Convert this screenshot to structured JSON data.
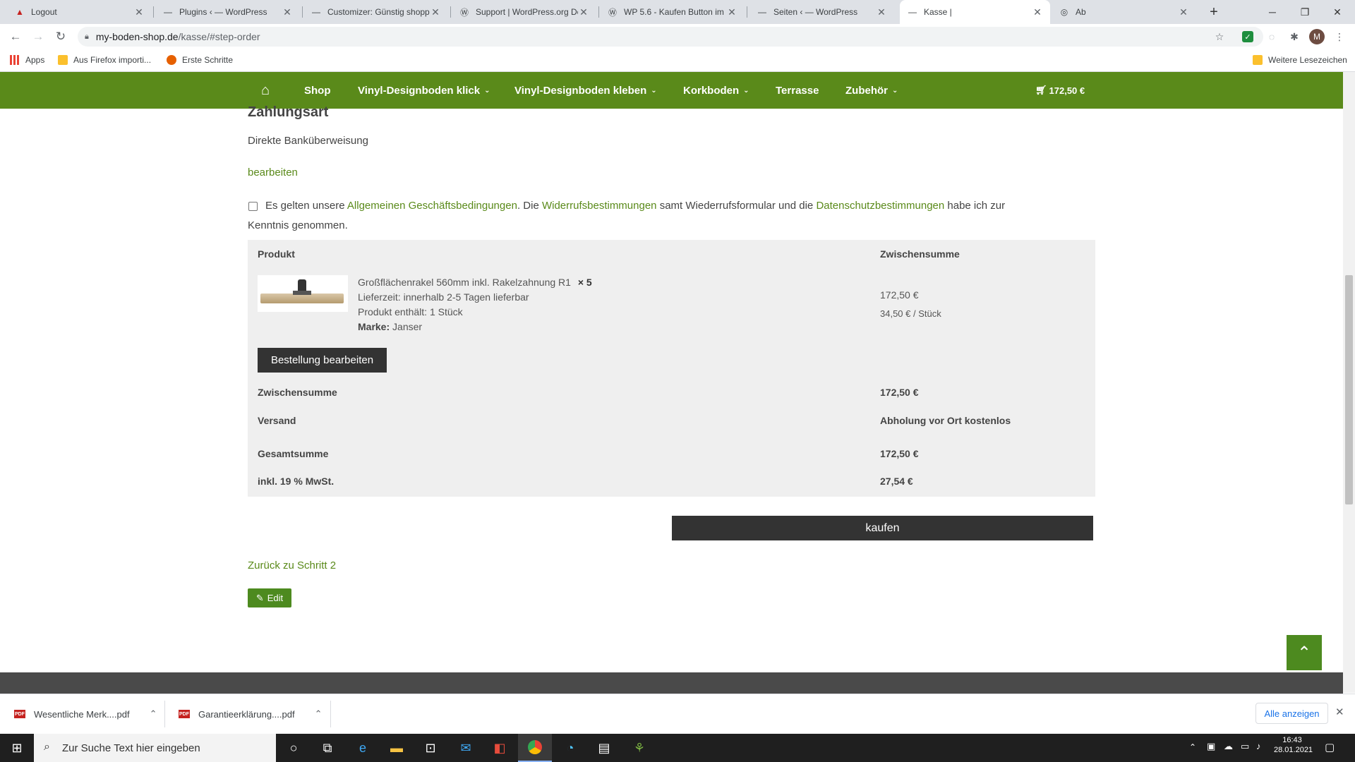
{
  "browser": {
    "tabs": [
      {
        "title": "Logout",
        "icon": "wp-icon",
        "active": false
      },
      {
        "title": "Plugins ‹ — WordPress",
        "icon": "dash-icon",
        "active": false
      },
      {
        "title": "Customizer: Günstig shoppe",
        "icon": "dash-icon",
        "active": false
      },
      {
        "title": "Support | WordPress.org De",
        "icon": "wordpress-icon",
        "active": false
      },
      {
        "title": "WP 5.6 - Kaufen Button im",
        "icon": "wordpress-icon",
        "active": false
      },
      {
        "title": "Seiten ‹ — WordPress",
        "icon": "dash-icon",
        "active": false
      },
      {
        "title": "Kasse |",
        "icon": "dash-icon",
        "active": true
      },
      {
        "title": "Ab",
        "icon": "globe-icon",
        "active": false
      }
    ],
    "url_host": "my-boden-shop.de",
    "url_path": "/kasse/#step-order",
    "profile_initial": "M",
    "bookmarks": {
      "apps": "Apps",
      "firefox": "Aus Firefox importi...",
      "first_steps": "Erste Schritte",
      "more": "Weitere Lesezeichen"
    }
  },
  "nav": {
    "items": [
      {
        "label": "Shop",
        "caret": false
      },
      {
        "label": "Vinyl-Designboden klick",
        "caret": true
      },
      {
        "label": "Vinyl-Designboden kleben",
        "caret": true
      },
      {
        "label": "Korkboden",
        "caret": true
      },
      {
        "label": "Terrasse",
        "caret": false
      },
      {
        "label": "Zubehör",
        "caret": true
      }
    ],
    "cart_total": "172,50 €"
  },
  "checkout": {
    "payment_heading": "Zahlungsart",
    "payment_method": "Direkte Banküberweisung",
    "edit_link": "bearbeiten",
    "terms": {
      "prefix": "Es gelten unsere",
      "agb": "Allgemeinen Geschäftsbedingungen",
      "mid1": ". Die",
      "widerruf": "Widerrufsbestimmungen",
      "mid2": "samt Wiederrufsformular und die",
      "datenschutz": "Datenschutzbestimmungen",
      "suffix": "habe ich zur",
      "line2": "Kenntnis genommen."
    },
    "table": {
      "col_product": "Produkt",
      "col_subtotal": "Zwischensumme",
      "product_name": "Großflächenrakel 560mm inkl. Rakelzahnung R1",
      "quantity": "× 5",
      "delivery": "Lieferzeit: innerhalb 2-5 Tagen lieferbar",
      "contains": "Produkt enthält: 1 Stück",
      "brand_label": "Marke:",
      "brand_value": "Janser",
      "line_price": "172,50 €",
      "unit_price": "34,50 € / Stück",
      "edit_order": "Bestellung bearbeiten",
      "subtotal_label": "Zwischensumme",
      "subtotal_value": "172,50 €",
      "shipping_label": "Versand",
      "shipping_value": "Abholung vor Ort kostenlos",
      "total_label": "Gesamtsumme",
      "total_value": "172,50 €",
      "tax_label": "inkl. 19 % MwSt.",
      "tax_value": "27,54 €"
    },
    "buy_button": "kaufen",
    "back_link": "Zurück zu Schritt 2",
    "edit_button": "Edit"
  },
  "downloads": {
    "items": [
      "Wesentliche Merk....pdf",
      "Garantieerklärung....pdf"
    ],
    "show_all": "Alle anzeigen"
  },
  "taskbar": {
    "search_placeholder": "Zur Suche Text hier eingeben",
    "time": "16:43",
    "date": "28.01.2021"
  }
}
